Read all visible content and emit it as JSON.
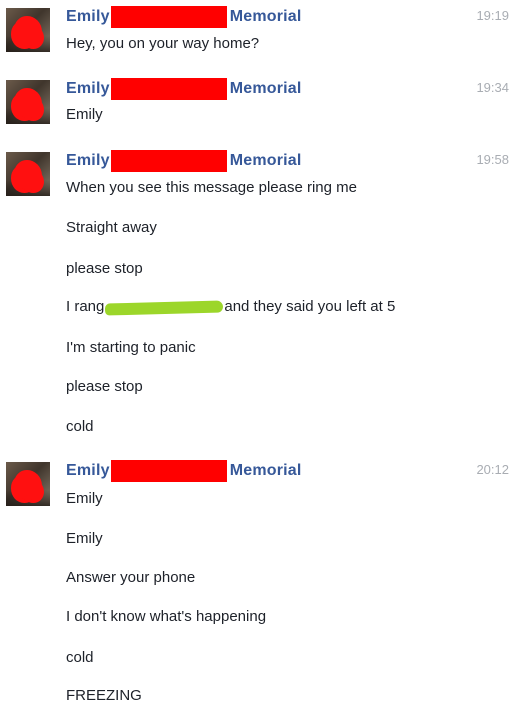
{
  "thread": {
    "groups": [
      {
        "sender_first": "Emily",
        "sender_last": "Memorial",
        "time": "19:19",
        "messages": [
          "Hey, you on your way home?"
        ]
      },
      {
        "sender_first": "Emily",
        "sender_last": "Memorial",
        "time": "19:34",
        "messages": [
          "Emily"
        ]
      },
      {
        "sender_first": "Emily",
        "sender_last": "Memorial",
        "time": "19:58",
        "messages": [
          "When you see this message please ring me",
          "Straight away",
          "please stop",
          {
            "before": "I rang",
            "after": "and they said you left at 5"
          },
          "I'm starting to panic",
          "please stop",
          "cold"
        ]
      },
      {
        "sender_first": "Emily",
        "sender_last": "Memorial",
        "time": "20:12",
        "messages": [
          "Emily",
          "Emily",
          "Answer your phone",
          "I don't know what's happening",
          "cold",
          "FREEZING"
        ]
      }
    ]
  },
  "colors": {
    "sender_name": "#365899",
    "timestamp": "#a9adb3",
    "redaction_red": "#ff0000",
    "redaction_green": "#9cd62a"
  },
  "icons": {
    "avatar": "profile-photo-redacted-icon"
  }
}
